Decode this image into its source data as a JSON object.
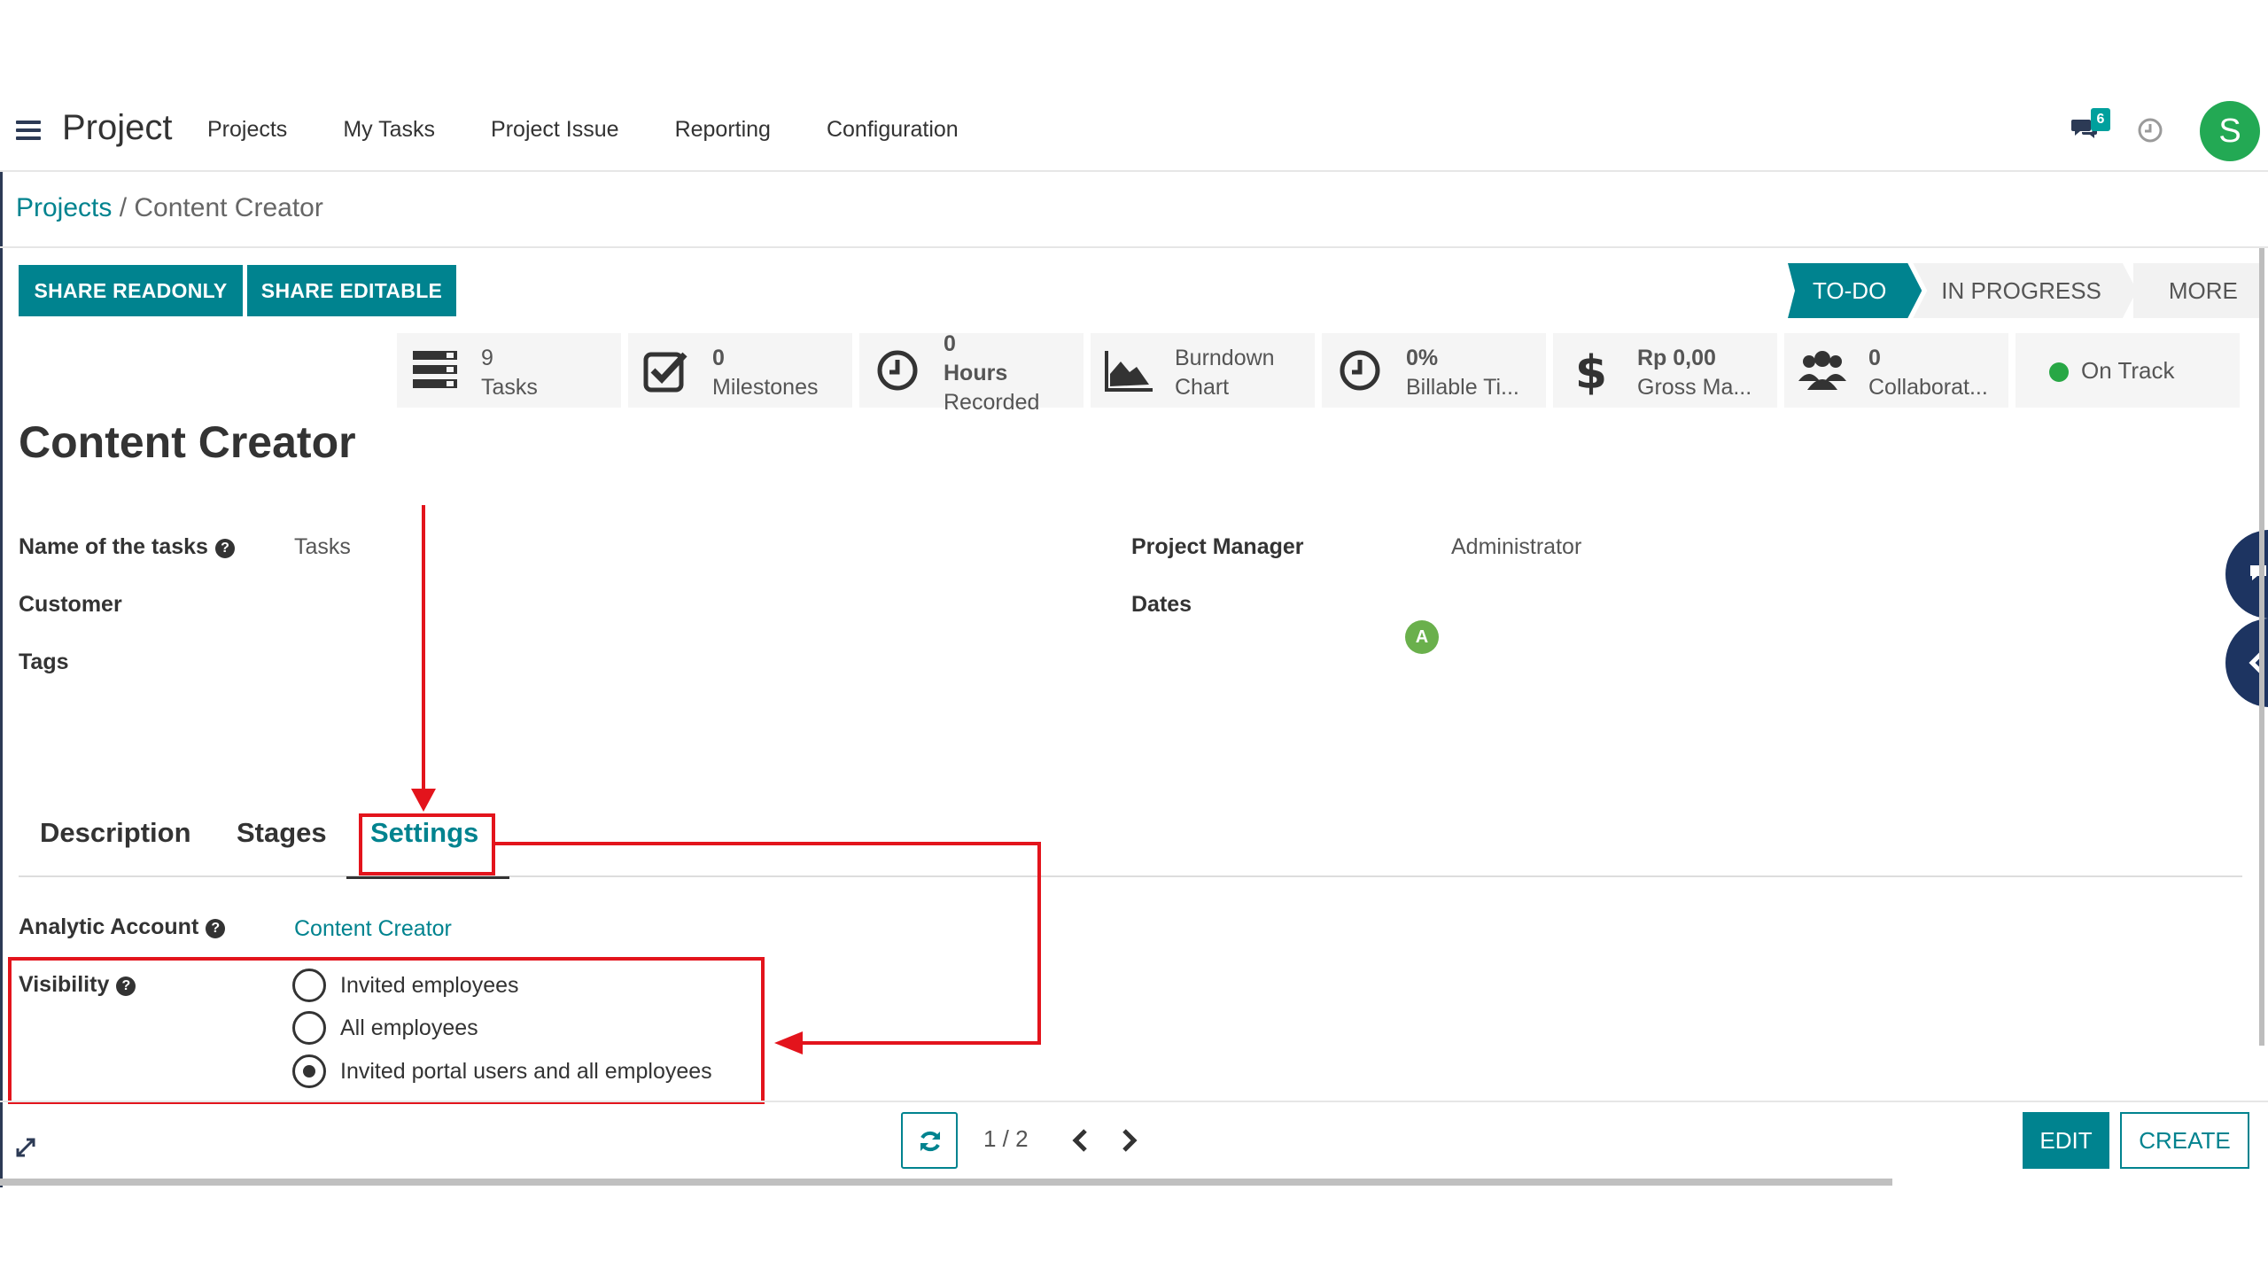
{
  "navbar": {
    "app_title": "Project",
    "menu": [
      "Projects",
      "My Tasks",
      "Project Issue",
      "Reporting",
      "Configuration"
    ],
    "chat_badge_count": "6",
    "user_initial": "S",
    "user_avatar_color": "#23a954"
  },
  "breadcrumb": {
    "parent": "Projects",
    "separator": " / ",
    "current": "Content Creator"
  },
  "control_panel": {
    "share_readonly": "SHARE READONLY",
    "share_editable": "SHARE EDITABLE",
    "stages": [
      "TO-DO",
      "IN PROGRESS",
      "MORE"
    ],
    "active_stage": "TO-DO"
  },
  "stats": {
    "tasks": {
      "value": "9",
      "label": "Tasks",
      "icon": "tasks-icon"
    },
    "milestones": {
      "value": "0",
      "label": "Milestones",
      "icon": "check-square-icon"
    },
    "hours": {
      "value": "0",
      "label1": "Hours",
      "label2": "Recorded",
      "icon": "clock-icon"
    },
    "burndown": {
      "label1": "Burndown",
      "label2": "Chart",
      "icon": "area-chart-icon"
    },
    "billable": {
      "value": "0%",
      "label": "Billable Ti...",
      "icon": "clock-icon"
    },
    "gross": {
      "value": "Rp 0,00",
      "label": "Gross Ma...",
      "icon": "dollar-icon"
    },
    "collaborators": {
      "value": "0",
      "label": "Collaborat...",
      "icon": "users-icon"
    },
    "status": {
      "label": "On Track",
      "color": "#28a745"
    }
  },
  "form": {
    "title": "Content Creator",
    "fields_left": {
      "name_of_tasks_label": "Name of the tasks",
      "name_of_tasks_value": "Tasks",
      "customer_label": "Customer",
      "tags_label": "Tags"
    },
    "fields_right": {
      "project_manager_label": "Project Manager",
      "project_manager_initial": "A",
      "project_manager_value": "Administrator",
      "dates_label": "Dates"
    },
    "tabs": [
      "Description",
      "Stages",
      "Settings"
    ],
    "active_tab": "Settings",
    "settings": {
      "analytic_account_label": "Analytic Account",
      "analytic_account_value": "Content Creator",
      "visibility_label": "Visibility",
      "visibility_options": [
        "Invited employees",
        "All employees",
        "Invited portal users and all employees"
      ],
      "visibility_selected": "Invited portal users and all employees"
    }
  },
  "footer": {
    "pager": "1 / 2",
    "edit": "EDIT",
    "create": "CREATE"
  },
  "colors": {
    "accent": "#00838f",
    "annotation_red": "#e3141c",
    "nav_dark": "#2c3a55"
  }
}
